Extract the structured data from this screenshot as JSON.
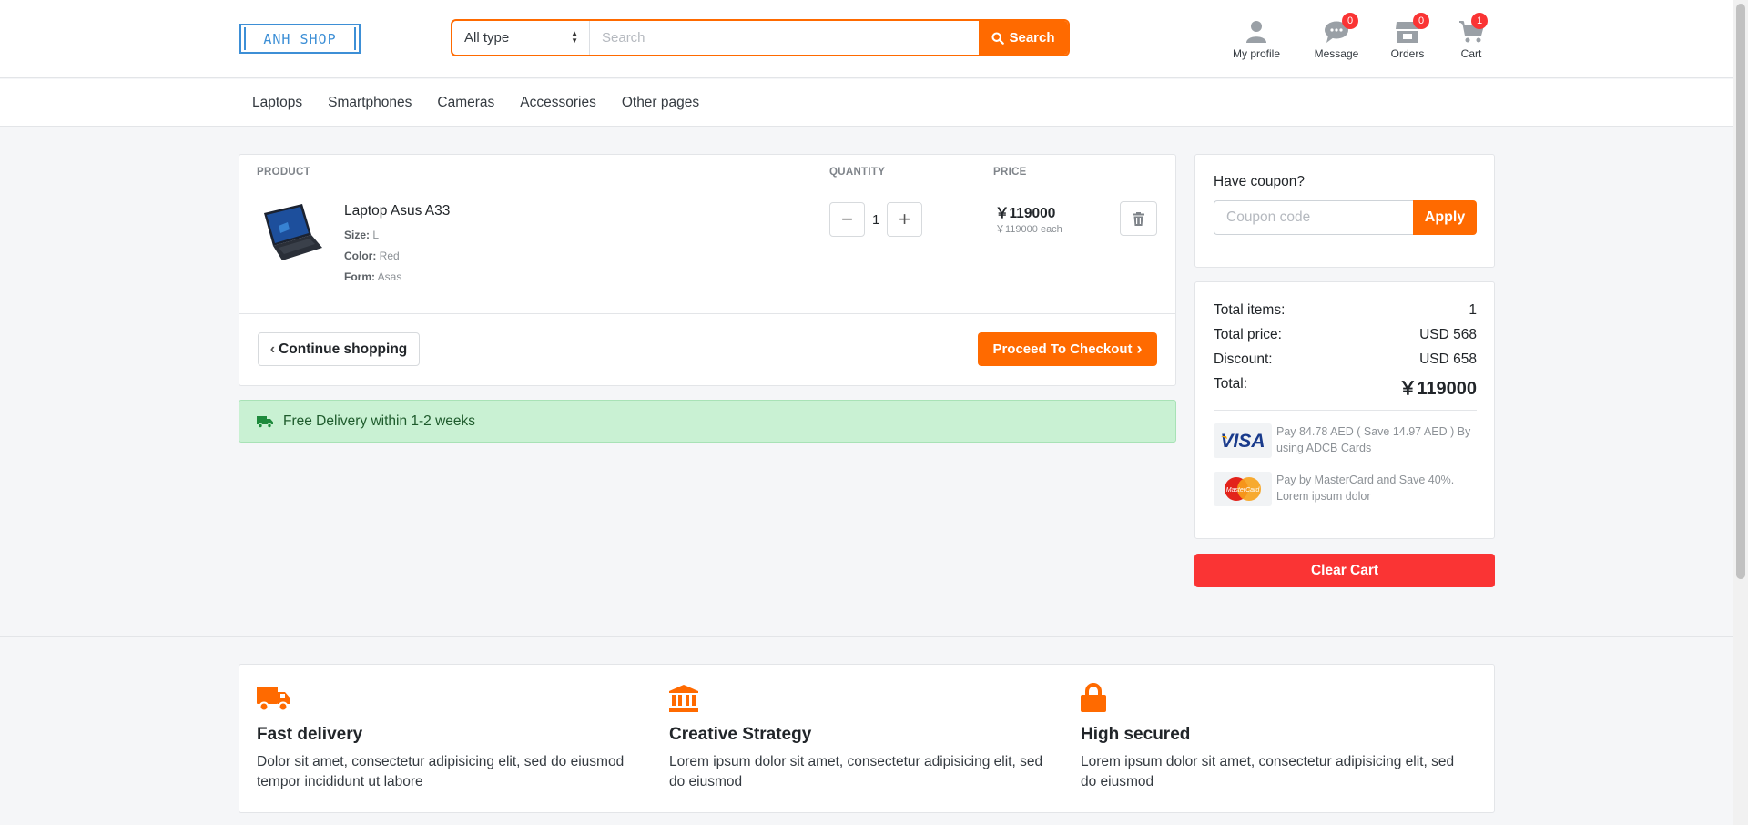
{
  "header": {
    "logo_text": "ANH SHOP",
    "search": {
      "type_selected": "All type",
      "placeholder": "Search",
      "button_label": "Search"
    },
    "icons": [
      {
        "name": "profile",
        "label": "My profile",
        "badge": null
      },
      {
        "name": "message",
        "label": "Message",
        "badge": "0"
      },
      {
        "name": "orders",
        "label": "Orders",
        "badge": "0"
      },
      {
        "name": "cart",
        "label": "Cart",
        "badge": "1"
      }
    ]
  },
  "nav": {
    "items": [
      "Laptops",
      "Smartphones",
      "Cameras",
      "Accessories",
      "Other pages"
    ]
  },
  "cart": {
    "columns": {
      "product": "PRODUCT",
      "quantity": "QUANTITY",
      "price": "PRICE"
    },
    "item": {
      "name": "Laptop Asus A33",
      "size_label": "Size:",
      "size": "L",
      "color_label": "Color:",
      "color": "Red",
      "form_label": "Form:",
      "form": "Asas",
      "quantity": "1",
      "price": "￥119000",
      "price_each": "￥119000 each"
    },
    "continue_label": "Continue shopping",
    "checkout_label": "Proceed To Checkout"
  },
  "delivery": {
    "text": "Free Delivery within 1-2 weeks"
  },
  "coupon": {
    "label": "Have coupon?",
    "placeholder": "Coupon code",
    "apply_label": "Apply"
  },
  "summary": {
    "total_items_label": "Total items:",
    "total_items": "1",
    "total_price_label": "Total price:",
    "total_price": "USD 568",
    "discount_label": "Discount:",
    "discount": "USD 658",
    "total_label": "Total:",
    "total": "￥119000",
    "visa_text": "Pay 84.78 AED ( Save 14.97 AED ) By using ADCB Cards",
    "mastercard_text": "Pay by MasterCard and Save 40%. Lorem ipsum dolor"
  },
  "clear_cart_label": "Clear Cart",
  "features": [
    {
      "title": "Fast delivery",
      "text": "Dolor sit amet, consectetur adipisicing elit, sed do eiusmod tempor incididunt ut labore"
    },
    {
      "title": "Creative Strategy",
      "text": "Lorem ipsum dolor sit amet, consectetur adipisicing elit, sed do eiusmod"
    },
    {
      "title": "High secured",
      "text": "Lorem ipsum dolor sit amet, consectetur adipisicing elit, sed do eiusmod"
    }
  ],
  "colors": {
    "accent": "#ff6a00",
    "danger": "#fa3434",
    "success_bg": "#c9f1d3",
    "logo": "#3d8fd6"
  }
}
